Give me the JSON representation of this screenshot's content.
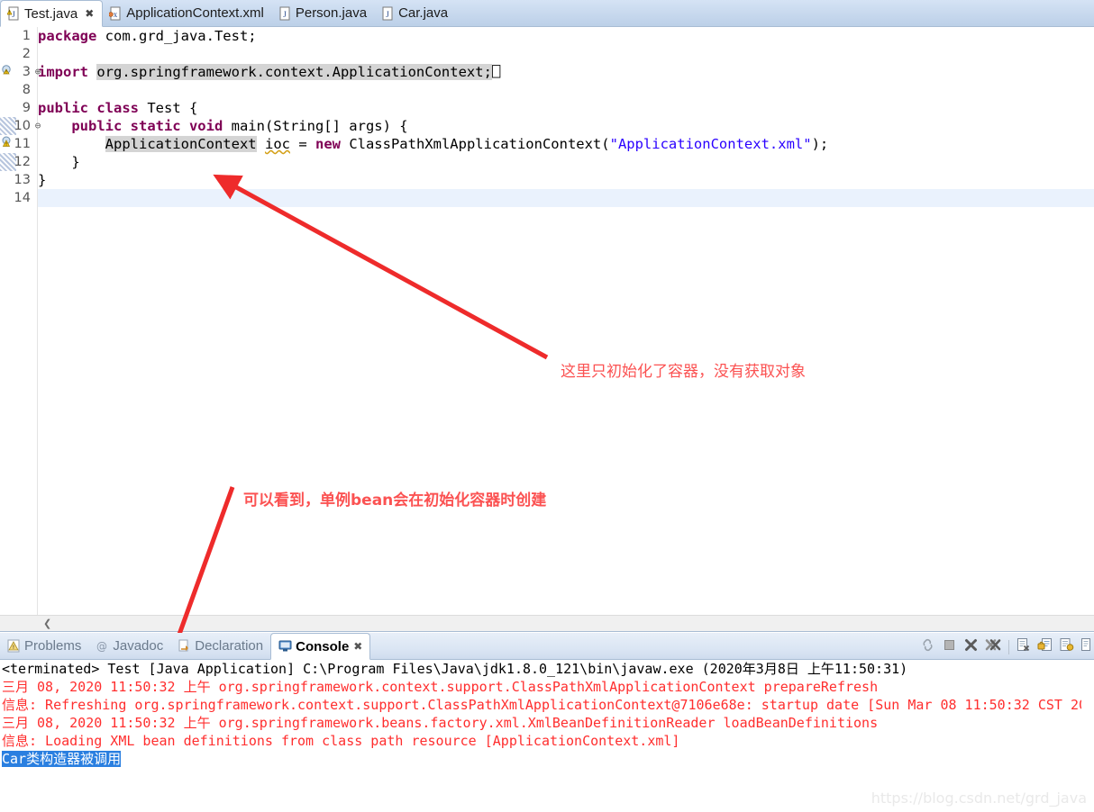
{
  "editor_tabs": [
    {
      "label": "Test.java",
      "icon": "java-file-warning-icon",
      "active": true,
      "closable": true
    },
    {
      "label": "ApplicationContext.xml",
      "icon": "xml-file-icon",
      "active": false,
      "closable": false
    },
    {
      "label": "Person.java",
      "icon": "java-file-icon",
      "active": false,
      "closable": false
    },
    {
      "label": "Car.java",
      "icon": "java-file-icon",
      "active": false,
      "closable": false
    }
  ],
  "code_lines": [
    {
      "num": "1",
      "fold": "",
      "marker": "none",
      "band": false,
      "current": false,
      "segments": [
        {
          "t": "package ",
          "c": "kw"
        },
        {
          "t": "com.grd_java.Test;",
          "c": "plain"
        }
      ]
    },
    {
      "num": "2",
      "fold": "",
      "marker": "none",
      "band": false,
      "current": false,
      "segments": []
    },
    {
      "num": "3",
      "fold": "+",
      "marker": "import",
      "band": false,
      "current": false,
      "segments": [
        {
          "t": "import ",
          "c": "kw"
        },
        {
          "t": "org.springframework.context.ApplicationContext;",
          "c": "hl"
        },
        {
          "t": "⎕",
          "c": "plain"
        }
      ]
    },
    {
      "num": "8",
      "fold": "",
      "marker": "none",
      "band": false,
      "current": false,
      "segments": []
    },
    {
      "num": "9",
      "fold": "",
      "marker": "none",
      "band": false,
      "current": false,
      "segments": [
        {
          "t": "public class ",
          "c": "kw"
        },
        {
          "t": "Test {",
          "c": "plain"
        }
      ]
    },
    {
      "num": "10",
      "fold": "-",
      "marker": "none",
      "band": true,
      "current": false,
      "segments": [
        {
          "t": "    ",
          "c": "plain"
        },
        {
          "t": "public static void ",
          "c": "kw"
        },
        {
          "t": "main(String[] args) {",
          "c": "plain"
        }
      ]
    },
    {
      "num": "11",
      "fold": "",
      "marker": "warning",
      "band": false,
      "current": false,
      "segments": [
        {
          "t": "        ",
          "c": "plain"
        },
        {
          "t": "ApplicationContext",
          "c": "hl"
        },
        {
          "t": " ",
          "c": "plain"
        },
        {
          "t": "ioc",
          "c": "squig"
        },
        {
          "t": " = ",
          "c": "plain"
        },
        {
          "t": "new ",
          "c": "kw"
        },
        {
          "t": "ClassPathXmlApplicationContext(",
          "c": "plain"
        },
        {
          "t": "\"ApplicationContext.xml\"",
          "c": "str"
        },
        {
          "t": ");",
          "c": "plain"
        }
      ]
    },
    {
      "num": "12",
      "fold": "",
      "marker": "none",
      "band": true,
      "current": false,
      "segments": [
        {
          "t": "    }",
          "c": "plain"
        }
      ]
    },
    {
      "num": "13",
      "fold": "",
      "marker": "none",
      "band": false,
      "current": false,
      "segments": [
        {
          "t": "}",
          "c": "plain"
        }
      ]
    },
    {
      "num": "14",
      "fold": "",
      "marker": "none",
      "band": false,
      "current": true,
      "segments": []
    }
  ],
  "annotations": [
    {
      "text": "这里只初始化了容器，没有获取对象",
      "bold": false
    },
    {
      "text": "可以看到，单例bean会在初始化容器时创建",
      "bold": true
    }
  ],
  "panel_tabs": [
    {
      "label": "Problems",
      "icon": "problems-icon",
      "active": false,
      "closable": false
    },
    {
      "label": "Javadoc",
      "icon": "javadoc-icon",
      "active": false,
      "closable": false
    },
    {
      "label": "Declaration",
      "icon": "declaration-icon",
      "active": false,
      "closable": false
    },
    {
      "label": "Console",
      "icon": "console-icon",
      "active": true,
      "closable": true
    }
  ],
  "panel_tools": [
    {
      "name": "scroll-lock-icon"
    },
    {
      "name": "terminate-icon"
    },
    {
      "name": "remove-launch-icon"
    },
    {
      "name": "remove-all-terminated-icon"
    },
    {
      "name": "clear-console-icon"
    },
    {
      "name": "pin-console-icon"
    },
    {
      "name": "display-selected-console-icon"
    },
    {
      "name": "open-console-icon"
    }
  ],
  "console": {
    "launch_header": "<terminated> Test [Java Application] C:\\Program Files\\Java\\jdk1.8.0_121\\bin\\javaw.exe (2020年3月8日 上午11:50:31)",
    "lines": [
      "三月 08, 2020 11:50:32 上午 org.springframework.context.support.ClassPathXmlApplicationContext prepareRefresh",
      "信息: Refreshing org.springframework.context.support.ClassPathXmlApplicationContext@7106e68e: startup date [Sun Mar 08 11:50:32 CST 202",
      "三月 08, 2020 11:50:32 上午 org.springframework.beans.factory.xml.XmlBeanDefinitionReader loadBeanDefinitions",
      "信息: Loading XML bean definitions from class path resource [ApplicationContext.xml]"
    ],
    "selected_line": "Car类构造器被调用"
  },
  "watermark": "https://blog.csdn.net/grd_java",
  "colors": {
    "annotation": "#fb5252",
    "console_error": "#ff2e2e",
    "selection": "#2a7fe0",
    "keyword": "#7f0055",
    "string": "#2a00ff"
  }
}
